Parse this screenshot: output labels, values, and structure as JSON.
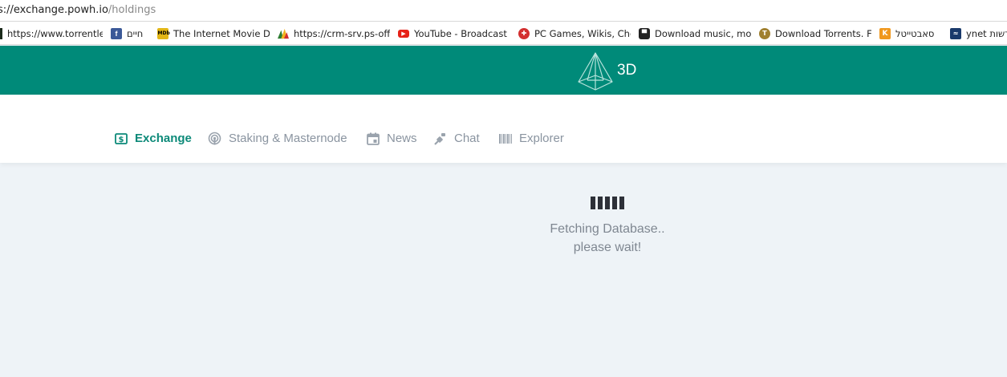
{
  "browser": {
    "url_host": "s://exchange.powh.io",
    "url_path": "/holdings",
    "bookmarks": [
      {
        "label": "https://www.torrentle",
        "icon": "dark-square-icon",
        "color": "#1b2a1b"
      },
      {
        "label": "חיים",
        "icon": "facebook-icon",
        "color": "#3b5998"
      },
      {
        "label": "The Internet Movie D",
        "icon": "imdb-icon",
        "color": "#e2b616"
      },
      {
        "label": "https://crm-srv.ps-off",
        "icon": "crm-icon",
        "color": "#2d7d32"
      },
      {
        "label": "YouTube - Broadcast",
        "icon": "youtube-icon",
        "color": "#e62117"
      },
      {
        "label": "PC Games, Wikis, Che",
        "icon": "games-icon",
        "color": "#d32f2f"
      },
      {
        "label": "Download music, mo",
        "icon": "download-music-icon",
        "color": "#222222"
      },
      {
        "label": "Download Torrents. F",
        "icon": "torrent-shield-icon",
        "color": "#a08030"
      },
      {
        "label": "סאבטייטל",
        "icon": "k-icon",
        "color": "#f0981e"
      },
      {
        "label": "ynet חדשות",
        "icon": "ynet-icon",
        "color": "#1a3a6b"
      }
    ]
  },
  "header": {
    "brand": "3D",
    "logo_icon": "pyramid-icon",
    "bg_color": "#008a79"
  },
  "nav": {
    "items": [
      {
        "label": "Exchange",
        "icon": "dollar-icon",
        "active": true
      },
      {
        "label": "Staking & Masternode",
        "icon": "broadcast-icon",
        "active": false
      },
      {
        "label": "News",
        "icon": "calendar-icon",
        "active": false
      },
      {
        "label": "Chat",
        "icon": "chat-icon",
        "active": false
      },
      {
        "label": "Explorer",
        "icon": "barcode-icon",
        "active": false
      }
    ],
    "active_color": "#0d8a79"
  },
  "loading": {
    "line1": "Fetching Database..",
    "line2": "please wait!"
  }
}
